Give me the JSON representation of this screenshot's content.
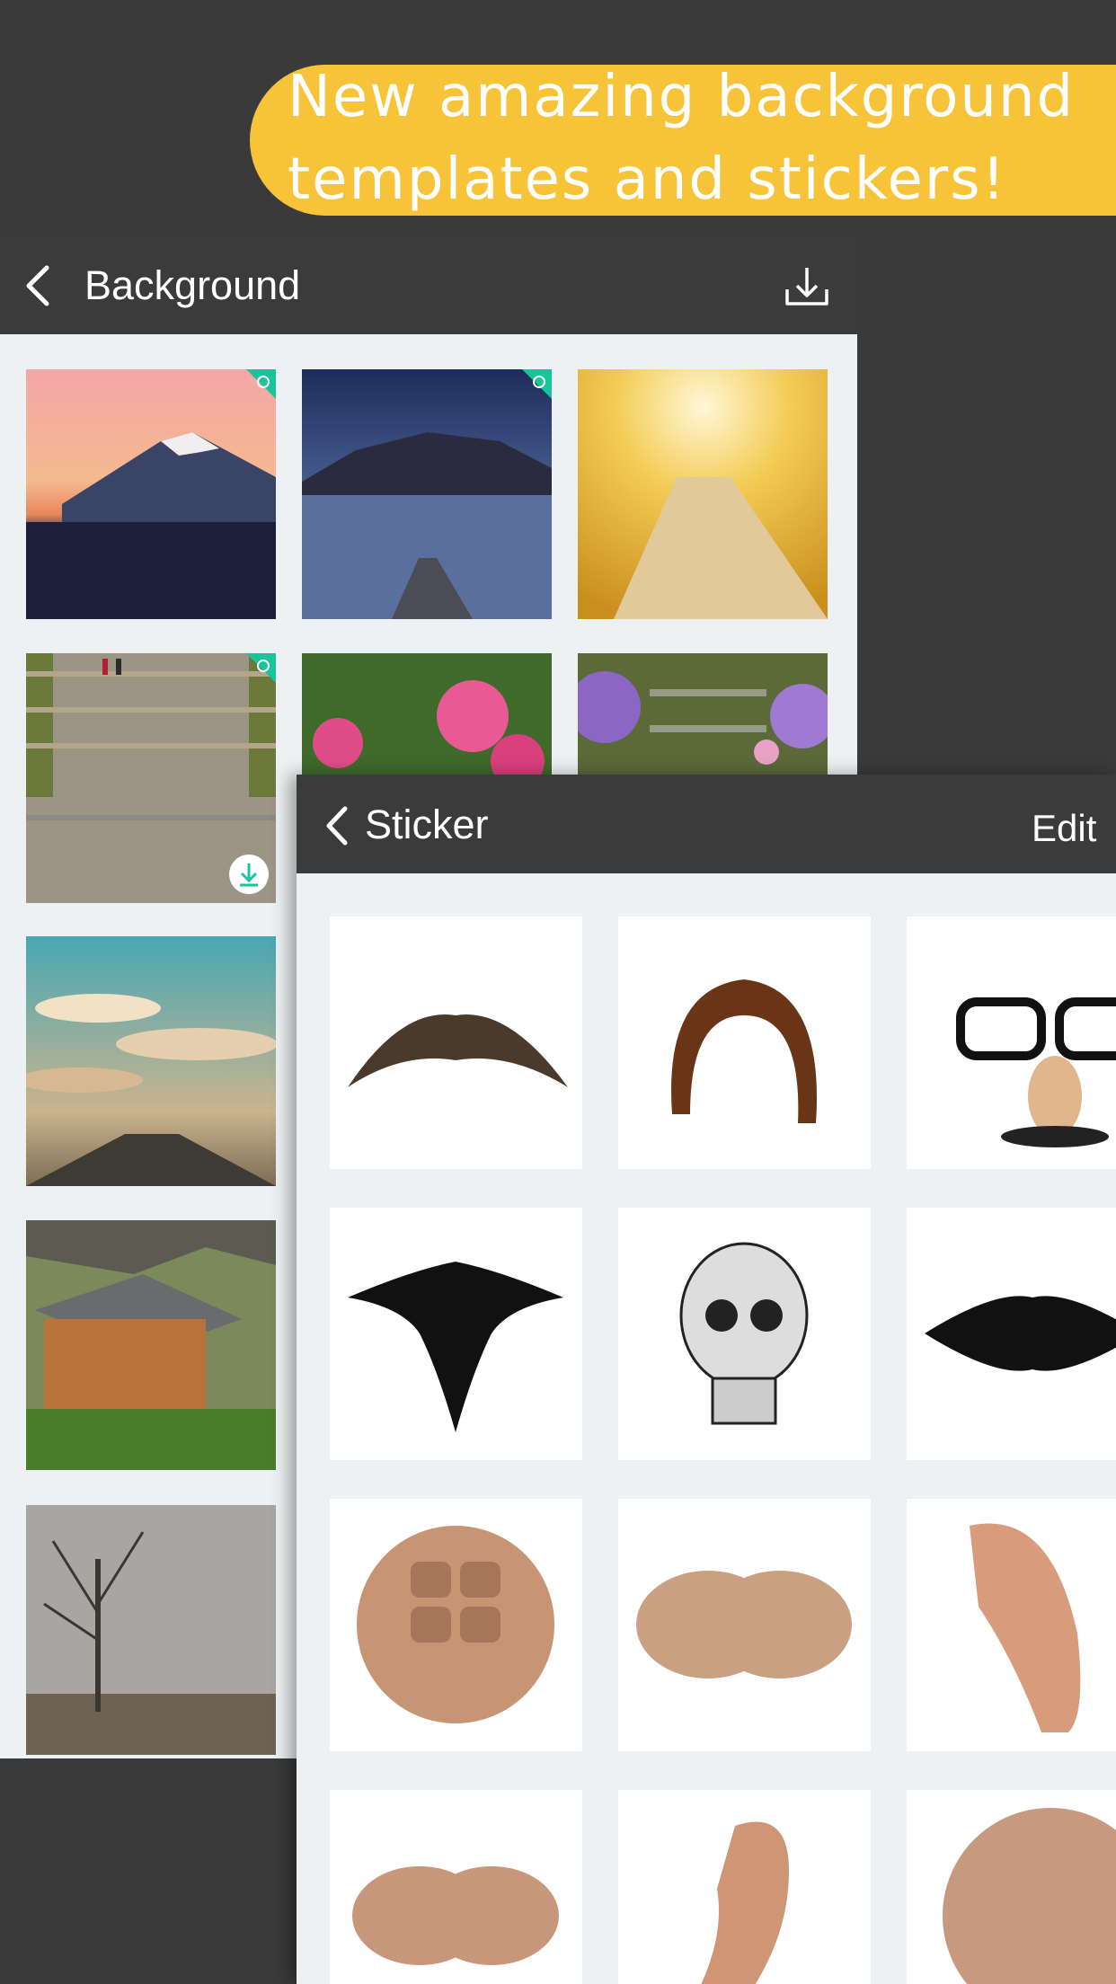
{
  "promo": {
    "line1": "New amazing background",
    "line2": "templates and stickers!"
  },
  "background_panel": {
    "title": "Background",
    "icons": {
      "back": "chevron-left-icon",
      "download": "download-icon",
      "lock": "lock-badge-icon",
      "tile_download": "download-circle-icon"
    },
    "tiles": [
      {
        "name": "mountain-sunset",
        "locked": true
      },
      {
        "name": "lake-pier-night",
        "locked": true
      },
      {
        "name": "autumn-forest-road",
        "locked": false
      },
      {
        "name": "leaf-stone-steps",
        "locked": true,
        "downloadable": true
      },
      {
        "name": "garden-azaleas",
        "locked": false
      },
      {
        "name": "flower-stairs",
        "locked": false
      },
      {
        "name": "pier-clouds",
        "locked": false
      },
      {
        "name": "log-cabin",
        "locked": false
      },
      {
        "name": "foggy-tree",
        "locked": false
      }
    ]
  },
  "sticker_panel": {
    "title": "Sticker",
    "edit_label": "Edit",
    "stickers": [
      "mustache-chevron",
      "mustache-horseshoe",
      "disguise-glasses",
      "tribal-tattoo-dragon",
      "skull-tattoo",
      "tribal-tattoo-band",
      "abs-six-pack",
      "chest-muscles",
      "arm-bicep",
      "chest-pecs",
      "arm-flex",
      "abs-partial"
    ]
  },
  "colors": {
    "dark_bg": "#3a3a3a",
    "banner_yellow": "#f7c338",
    "grid_bg": "#eef1f3",
    "lock_green": "#18c49a"
  }
}
